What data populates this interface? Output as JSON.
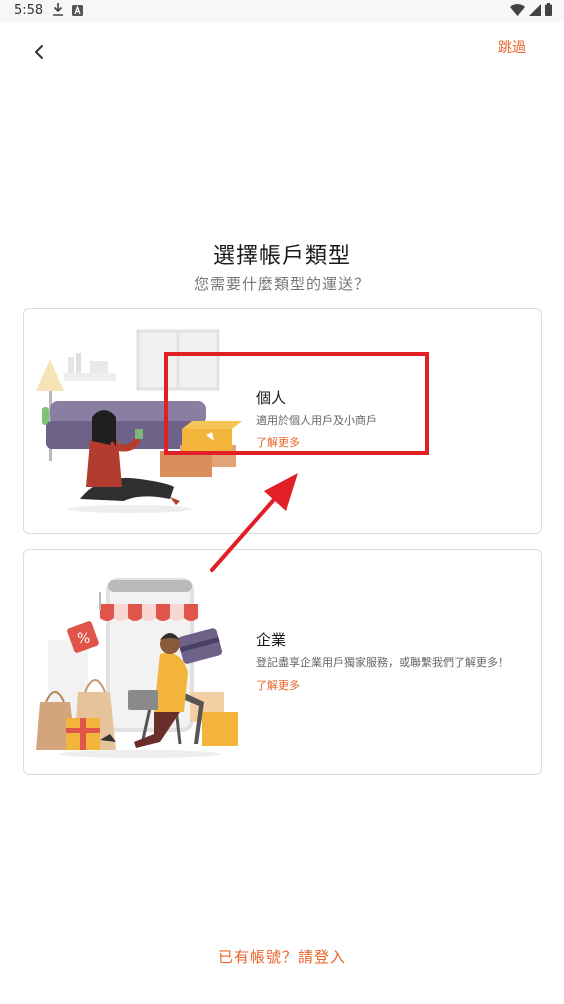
{
  "status_bar": {
    "time": "5:58"
  },
  "header": {
    "skip_label": "跳過"
  },
  "title": "選擇帳戶類型",
  "subtitle": "您需要什麼類型的運送？",
  "cards": [
    {
      "title": "個人",
      "description": "適用於個人用戶及小商戶",
      "link": "了解更多"
    },
    {
      "title": "企業",
      "description": "登記盡享企業用戶獨家服務，或聯繫我們了解更多！",
      "link": "了解更多"
    }
  ],
  "footer": {
    "login_label": "已有帳號？請登入"
  },
  "colors": {
    "accent": "#e8642a",
    "highlight": "#e21f26"
  }
}
